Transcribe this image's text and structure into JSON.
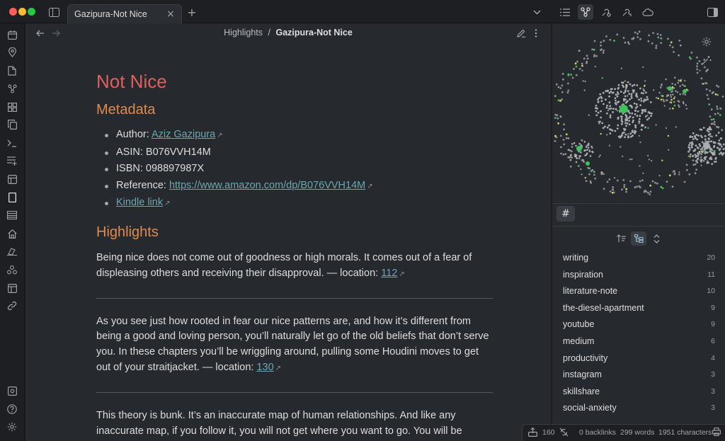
{
  "tab": {
    "title": "Gazipura-Not Nice",
    "close": "×",
    "new_tab": "+"
  },
  "breadcrumb": {
    "folder": "Highlights",
    "separator": "/",
    "file": "Gazipura-Not Nice"
  },
  "note": {
    "title": "Not Nice",
    "metadata_heading": "Metadata",
    "author_label": "Author: ",
    "author_value": "Aziz Gazipura",
    "asin": "ASIN: B076VVH14M",
    "isbn": "ISBN: 098897987X",
    "reference_label": "Reference: ",
    "reference_url": "https://www.amazon.com/dp/B076VVH14M",
    "kindle_link": "Kindle link",
    "highlights_heading": "Highlights",
    "highlights": [
      {
        "text": "Being nice does not come out of goodness or high morals. It comes out of a fear of displeasing others and receiving their disapproval. — location: ",
        "location": "112"
      },
      {
        "text": "As you see just how rooted in fear our nice patterns are, and how it’s different from being a good and loving person, you’ll naturally let go of the old beliefs that don’t serve you. In these chapters you’ll be wriggling around, pulling some Houdini moves to get out of your straitjacket. — location: ",
        "location": "130"
      },
      {
        "text": "This theory is bunk. It’s an inaccurate map of human relationships. And like any inaccurate map, if you follow it, you will not get where you want to go. You will be",
        "location": ""
      }
    ]
  },
  "tags": [
    {
      "name": "writing",
      "count": "20"
    },
    {
      "name": "inspiration",
      "count": "11"
    },
    {
      "name": "literature-note",
      "count": "10"
    },
    {
      "name": "the-diesel-apartment",
      "count": "9"
    },
    {
      "name": "youtube",
      "count": "9"
    },
    {
      "name": "medium",
      "count": "6"
    },
    {
      "name": "productivity",
      "count": "4"
    },
    {
      "name": "instagram",
      "count": "3"
    },
    {
      "name": "skillshare",
      "count": "3"
    },
    {
      "name": "social-anxiety",
      "count": "3"
    }
  ],
  "tags_panel": {
    "hash": "#"
  },
  "status": {
    "count": "160",
    "backlinks": "0 backlinks",
    "words": "299 words",
    "characters": "1951 characters"
  },
  "colors": {
    "h1": "#e0605e",
    "h2": "#e08a4f",
    "link": "#6aa7b2",
    "graph_green": "#3ec35a",
    "graph_yellow": "#d6d35a"
  }
}
